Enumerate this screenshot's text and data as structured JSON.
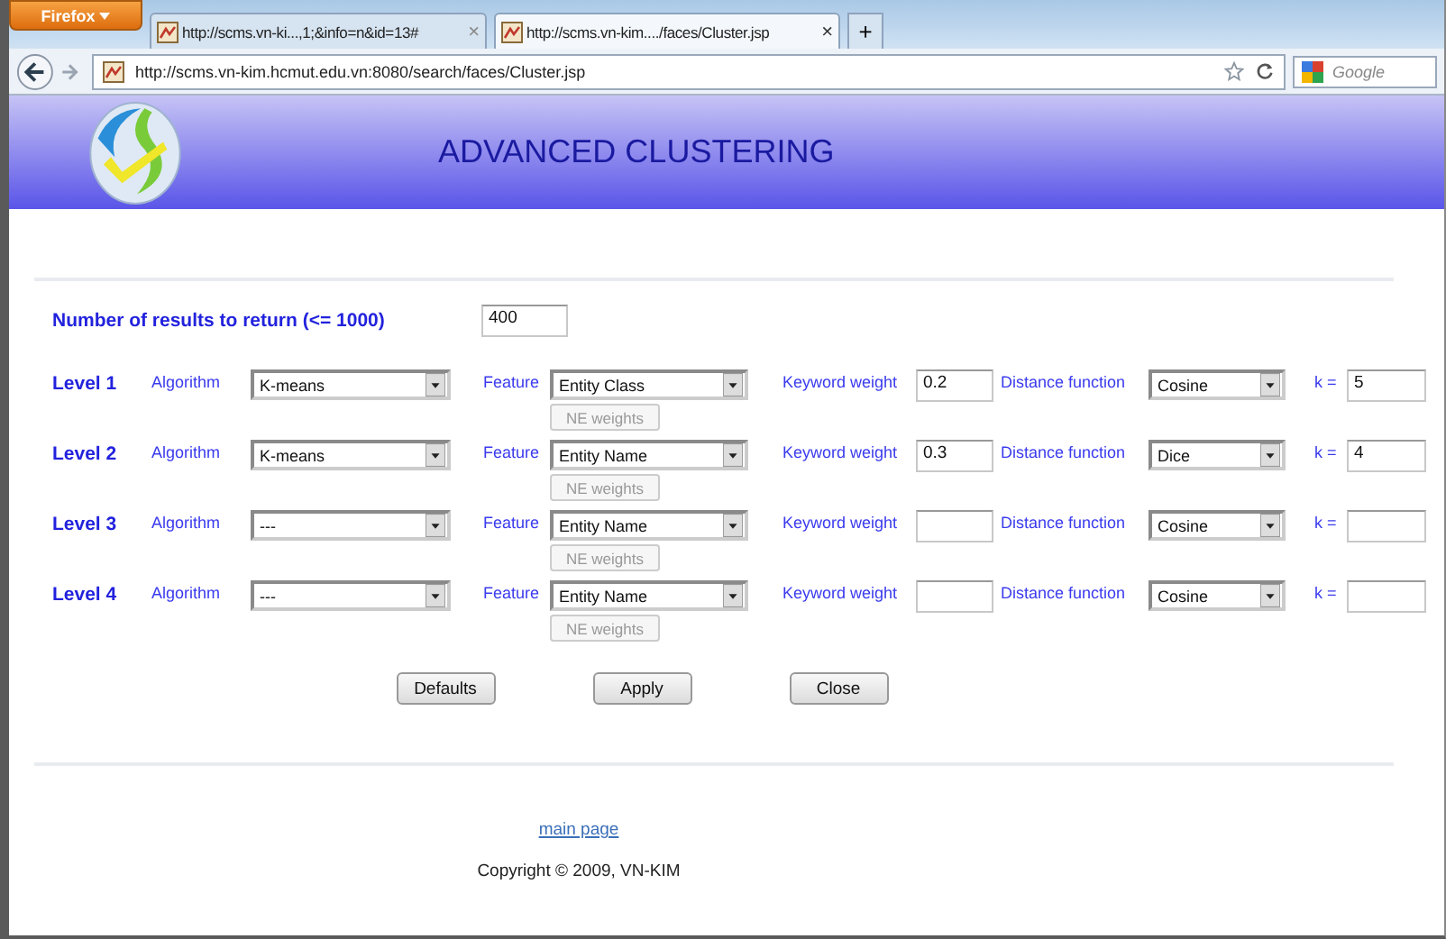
{
  "browser": {
    "menu_button": "Firefox",
    "tabs": [
      {
        "title": "http://scms.vn-ki...,1;&info=n&id=13#",
        "close": "×",
        "selected": false
      },
      {
        "title": "http://scms.vn-kim..../faces/Cluster.jsp",
        "close": "×",
        "selected": true
      }
    ],
    "new_tab": "+",
    "url": "http://scms.vn-kim.hcmut.edu.vn:8080/search/faces/Cluster.jsp",
    "search_placeholder": "Google"
  },
  "header": {
    "title": "ADVANCED CLUSTERING"
  },
  "results": {
    "label": "Number of results to return (<= 1000)",
    "value": "400"
  },
  "levels": [
    {
      "label": "Level 1",
      "algorithm_label": "Algorithm",
      "algorithm": "K-means",
      "feature_label": "Feature",
      "feature": "Entity Class",
      "ne_button": {
        "label": "NE weights",
        "disabled": true
      },
      "keyword_label": "Keyword weight",
      "keyword_weight": "0.2",
      "distance_label": "Distance function",
      "distance": "Cosine",
      "k_label": "k =",
      "k": "5"
    },
    {
      "label": "Level 2",
      "algorithm_label": "Algorithm",
      "algorithm": "K-means",
      "feature_label": "Feature",
      "feature": "Entity Name",
      "ne_button": {
        "label": "NE weights",
        "disabled": true
      },
      "keyword_label": "Keyword weight",
      "keyword_weight": "0.3",
      "distance_label": "Distance function",
      "distance": "Dice",
      "k_label": "k =",
      "k": "4"
    },
    {
      "label": "Level 3",
      "algorithm_label": "Algorithm",
      "algorithm": "---",
      "feature_label": "Feature",
      "feature": "Entity Name",
      "ne_button": {
        "label": "NE weights",
        "disabled": true
      },
      "keyword_label": "Keyword weight",
      "distance_label": "Distance function",
      "distance": "Cosine",
      "k_label": "k ="
    },
    {
      "label": "Level 4",
      "algorithm_label": "Algorithm",
      "algorithm": "---",
      "feature_label": "Feature",
      "feature": "Entity Name",
      "ne_button": {
        "label": "NE weights",
        "disabled": true
      },
      "keyword_label": "Keyword weight",
      "distance_label": "Distance function",
      "distance": "Cosine",
      "k_label": "k ="
    }
  ],
  "buttons": [
    "Defaults",
    "Apply",
    "Close"
  ],
  "footer": {
    "link": "main page",
    "copyright": "Copyright © 2009, VN-KIM"
  }
}
